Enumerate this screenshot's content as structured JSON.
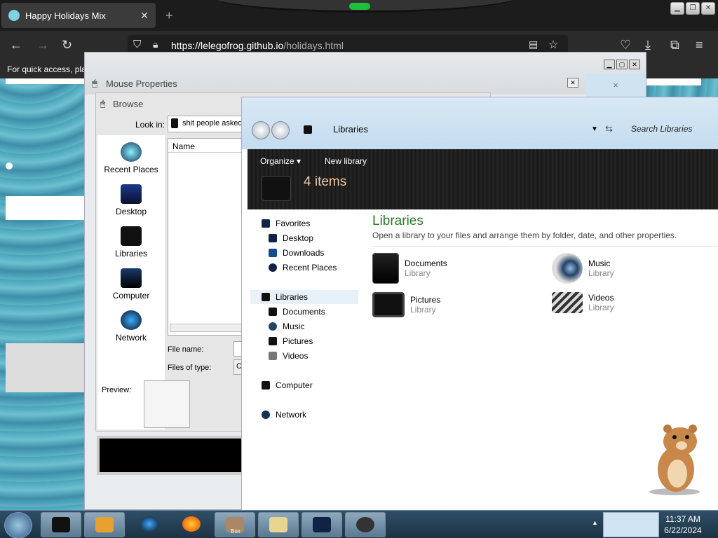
{
  "browser": {
    "tab_title": "Happy Holidays Mix",
    "url_host": "https://lelegofrog.github.io",
    "url_path": "/holidays.html",
    "bookmarks_text": "For quick access, plac"
  },
  "mouse_window": {
    "title": "Mouse Properties"
  },
  "browse_dialog": {
    "title": "Browse",
    "look_in_label": "Look in:",
    "look_in_value": "shit people asked",
    "name_column": "Name",
    "file_name_label": "File name:",
    "file_type_label": "Files of type:",
    "file_type_value": "C",
    "preview_label": "Preview:",
    "places": [
      "Recent Places",
      "Desktop",
      "Libraries",
      "Computer",
      "Network"
    ]
  },
  "libraries_window": {
    "breadcrumb": "Libraries",
    "search_placeholder": "Search Libraries",
    "organize_label": "Organize",
    "new_library_label": "New library",
    "item_count": "4 items",
    "heading": "Libraries",
    "description": "Open a library to your files and arrange them by folder, date, and other properties.",
    "nav": {
      "favorites": "Favorites",
      "desktop": "Desktop",
      "downloads": "Downloads",
      "recent_places": "Recent Places",
      "libraries": "Libraries",
      "documents": "Documents",
      "music": "Music",
      "pictures": "Pictures",
      "videos": "Videos",
      "computer": "Computer",
      "network": "Network"
    },
    "items": [
      {
        "name": "Documents",
        "type": "Library"
      },
      {
        "name": "Music",
        "type": "Library"
      },
      {
        "name": "Pictures",
        "type": "Library"
      },
      {
        "name": "Videos",
        "type": "Library"
      }
    ]
  },
  "taskbar": {
    "time": "11:37 AM",
    "date": "6/22/2024",
    "box_label": "Box"
  }
}
